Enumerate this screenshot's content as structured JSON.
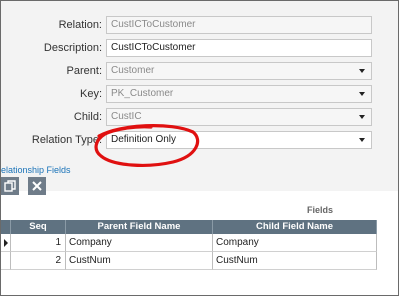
{
  "form": {
    "relation": {
      "label": "Relation:",
      "value": "CustICToCustomer"
    },
    "description": {
      "label": "Description:",
      "value": "CustICToCustomer"
    },
    "parent": {
      "label": "Parent:",
      "value": "Customer"
    },
    "key": {
      "label": "Key:",
      "value": "PK_Customer"
    },
    "child": {
      "label": "Child:",
      "value": "CustIC"
    },
    "relation_type": {
      "label": "Relation Type:",
      "value": "Definition Only"
    }
  },
  "section": {
    "title": "elationship Fields"
  },
  "toolbar": {
    "copy_icon": "copy-icon",
    "delete_icon": "close-icon"
  },
  "grid": {
    "panel_title": "Fields",
    "columns": [
      "Seq",
      "Parent Field Name",
      "Child Field Name"
    ],
    "rows": [
      {
        "seq": "1",
        "parent": "Company",
        "child": "Company",
        "current": true
      },
      {
        "seq": "2",
        "parent": "CustNum",
        "child": "CustNum",
        "current": false
      }
    ]
  },
  "annotation": {
    "color": "#e01010",
    "shape": "hand-drawn-circle"
  },
  "colors": {
    "header_bg": "#5f7281",
    "toolbar_btn": "#6f7c89",
    "link": "#1a73b8"
  }
}
